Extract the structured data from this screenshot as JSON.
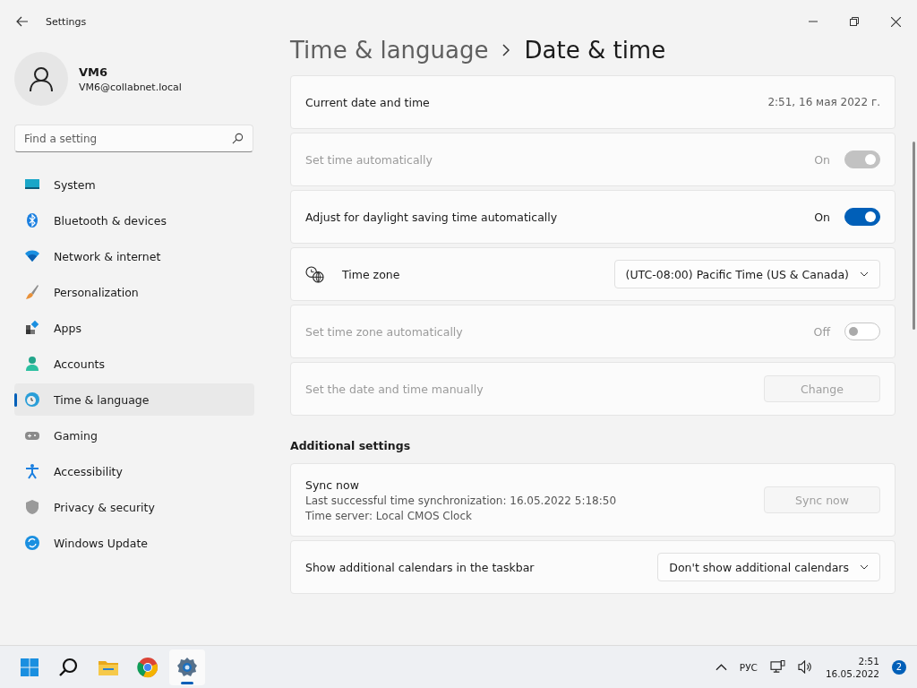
{
  "window": {
    "title": "Settings"
  },
  "user": {
    "name": "VM6",
    "email": "VM6@collabnet.local"
  },
  "search": {
    "placeholder": "Find a setting"
  },
  "nav": [
    {
      "label": "System",
      "selected": false
    },
    {
      "label": "Bluetooth & devices",
      "selected": false
    },
    {
      "label": "Network & internet",
      "selected": false
    },
    {
      "label": "Personalization",
      "selected": false
    },
    {
      "label": "Apps",
      "selected": false
    },
    {
      "label": "Accounts",
      "selected": false
    },
    {
      "label": "Time & language",
      "selected": true
    },
    {
      "label": "Gaming",
      "selected": false
    },
    {
      "label": "Accessibility",
      "selected": false
    },
    {
      "label": "Privacy & security",
      "selected": false
    },
    {
      "label": "Windows Update",
      "selected": false
    }
  ],
  "breadcrumb": {
    "parent": "Time & language",
    "current": "Date & time"
  },
  "settings": [
    {
      "kind": "info",
      "label": "Current date and time",
      "value": "2:51, 16 мая 2022 г."
    },
    {
      "kind": "toggle",
      "label": "Set time automatically",
      "state_text": "On",
      "on": true,
      "disabled": true
    },
    {
      "kind": "toggle",
      "label": "Adjust for daylight saving time automatically",
      "state_text": "On",
      "on": true,
      "disabled": false
    },
    {
      "kind": "select",
      "label": "Time zone",
      "value": "(UTC-08:00) Pacific Time (US & Canada)"
    },
    {
      "kind": "toggle",
      "label": "Set time zone automatically",
      "state_text": "Off",
      "on": false,
      "disabled": true
    },
    {
      "kind": "button",
      "label": "Set the date and time manually",
      "button": "Change",
      "disabled": true
    }
  ],
  "additional": {
    "heading": "Additional settings",
    "rows": [
      {
        "kind": "sync",
        "title": "Sync now",
        "lines": [
          "Last successful time synchronization: 16.05.2022 5:18:50",
          "Time server: Local CMOS Clock"
        ],
        "button": "Sync now",
        "disabled": true
      },
      {
        "kind": "select",
        "label": "Show additional calendars in the taskbar",
        "value": "Don't show additional calendars"
      }
    ]
  },
  "taskbar": {
    "apps": [
      {
        "selected": false
      },
      {
        "selected": false
      },
      {
        "selected": false
      },
      {
        "selected": false
      },
      {
        "selected": true
      }
    ],
    "language": "РУС",
    "time": "2:51",
    "date": "16.05.2022",
    "badge": "2"
  }
}
